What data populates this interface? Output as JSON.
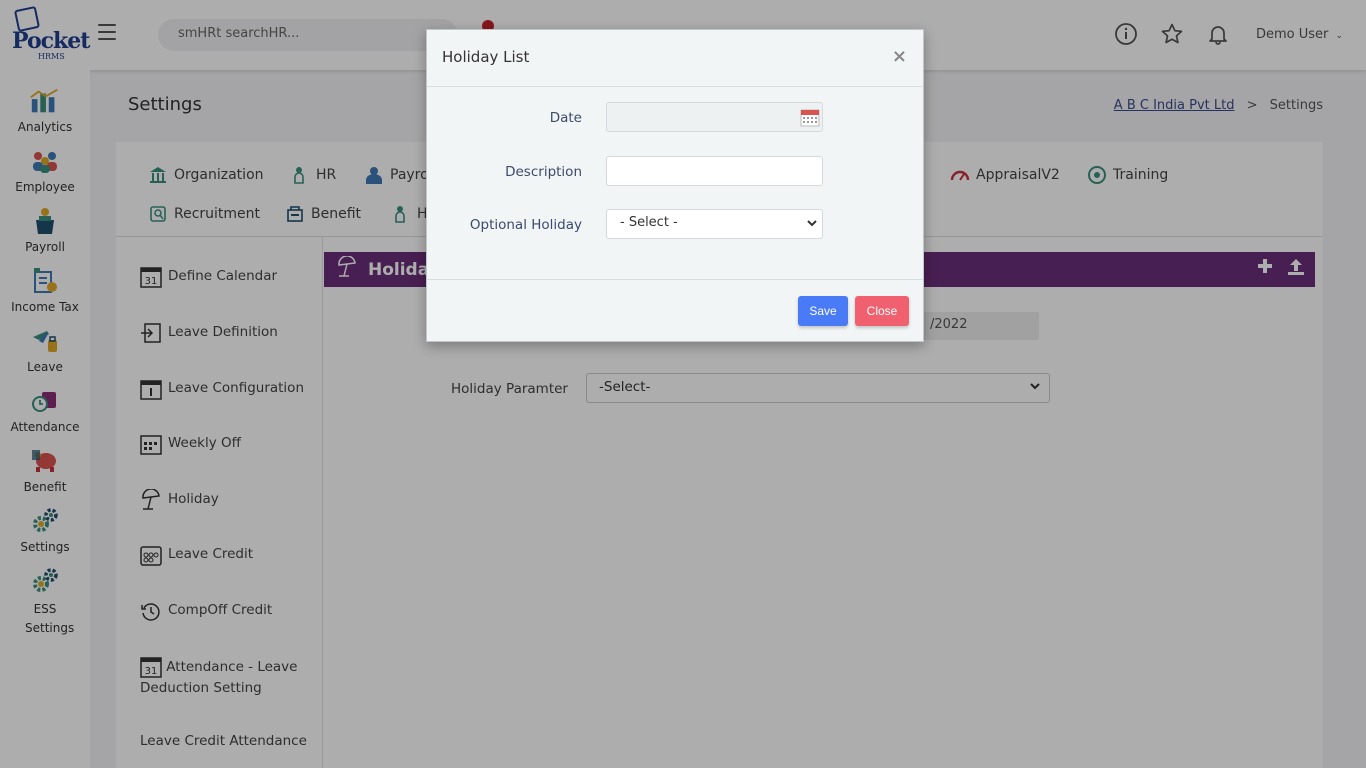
{
  "logo": {
    "main": "Pocket",
    "sub": "HRMS"
  },
  "topbar": {
    "search_placeholder": "smHRt searchHR...",
    "user_name": "Demo User",
    "icons": [
      "info-icon",
      "star-icon",
      "bell-icon"
    ]
  },
  "sidebar": {
    "items": [
      {
        "label": "Analytics",
        "icon": "analytics-icon"
      },
      {
        "label": "Employee",
        "icon": "employee-icon"
      },
      {
        "label": "Payroll",
        "icon": "payroll-icon"
      },
      {
        "label": "Income Tax",
        "icon": "income-tax-icon"
      },
      {
        "label": "Leave",
        "icon": "leave-icon"
      },
      {
        "label": "Attendance",
        "icon": "attendance-icon"
      },
      {
        "label": "Benefit",
        "icon": "benefit-icon"
      },
      {
        "label": "Settings",
        "icon": "settings-icon"
      },
      {
        "label": "ESS Settings",
        "icon": "ess-settings-icon"
      }
    ]
  },
  "page": {
    "title": "Settings",
    "breadcrumb_company": "A B C India Pvt Ltd",
    "breadcrumb_sep": ">",
    "breadcrumb_current": "Settings"
  },
  "tabs": {
    "row1": [
      "Organization",
      "HR",
      "Payro",
      "AppraisalV2",
      "Training"
    ],
    "row2": [
      "Recruitment",
      "Benefit",
      "Ho"
    ]
  },
  "left_menu": [
    "Define Calendar",
    "Leave Definition",
    "Leave Configuration",
    "Weekly Off",
    "Holiday",
    "Leave Credit",
    "CompOff Credit",
    "Attendance - Leave Deduction Setting",
    "Leave Credit Attendance"
  ],
  "panel": {
    "title": "Holiday",
    "date_value_fragment": "/2022",
    "holiday_param_label": "Holiday Paramter",
    "holiday_param_value": "-Select-"
  },
  "modal": {
    "title": "Holiday List",
    "close_glyph": "×",
    "date_label": "Date",
    "date_value": "",
    "description_label": "Description",
    "description_value": "",
    "optional_label": "Optional Holiday",
    "optional_value": "- Select -",
    "save_label": "Save",
    "close_label": "Close"
  },
  "colors": {
    "panel_header": "#6b2f7a",
    "save_button": "#4a7bf7",
    "close_button": "#f0606e",
    "link": "#3b4a8c"
  }
}
